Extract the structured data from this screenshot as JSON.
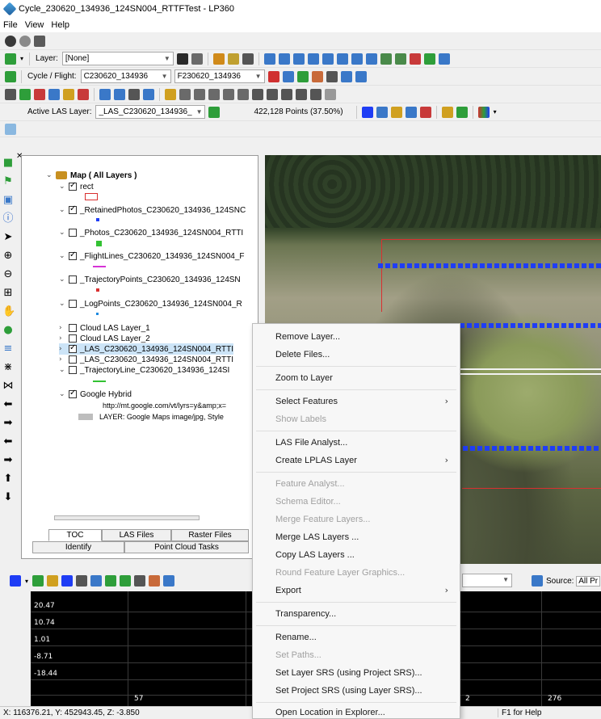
{
  "window": {
    "title": "Cycle_230620_134936_124SN004_RTTFTest - LP360"
  },
  "menu": [
    "File",
    "View",
    "Help"
  ],
  "toolbar": {
    "layer_label": "Layer:",
    "layer_value": "[None]",
    "cycle_label": "Cycle / Flight:",
    "cycle_value": "C230620_134936",
    "flight_value": "F230620_134936",
    "active_las_label": "Active LAS Layer:",
    "active_las_value": "_LAS_C230620_134936_",
    "points_text": "422,128 Points (37.50%)"
  },
  "toc": {
    "tree": [
      {
        "label": "Map ( All Layers )",
        "bold": true
      },
      {
        "label": "rect",
        "checked": true
      },
      {
        "label": "_RetainedPhotos_C230620_134936_124SNC",
        "checked": true
      },
      {
        "label": "_Photos_C230620_134936_124SN004_RTTI",
        "checked": false
      },
      {
        "label": "_FlightLines_C230620_134936_124SN004_F",
        "checked": true
      },
      {
        "label": "_TrajectoryPoints_C230620_134936_124SN",
        "checked": false
      },
      {
        "label": "_LogPoints_C230620_134936_124SN004_R",
        "checked": false
      },
      {
        "label": "Cloud LAS Layer_1",
        "checked": false
      },
      {
        "label": "Cloud LAS Layer_2",
        "checked": false
      },
      {
        "label": "_LAS_C230620_134936_124SN004_RTTI",
        "checked": true
      },
      {
        "label": "_LAS_C230620_134936_124SN004_RTTI",
        "checked": false
      },
      {
        "label": "_TrajectoryLine_C230620_134936_124SI",
        "checked": false
      },
      {
        "label": "Google Hybrid",
        "checked": true
      },
      {
        "label": "http://mt.google.com/vt/lyrs=y&amp;x="
      },
      {
        "label": "LAYER: Google Maps image/jpg, Style"
      }
    ],
    "tabs_row1": [
      "TOC",
      "LAS Files",
      "Raster Files"
    ],
    "tabs_row2": [
      "Identify",
      "Point Cloud Tasks"
    ]
  },
  "profile": {
    "y_labels": [
      "20.47",
      "10.74",
      "1.01",
      "-8.71",
      "-18.44"
    ],
    "x_labels": [
      "57",
      "2",
      "276"
    ],
    "source_label": "Source:",
    "source_value": "All Pr"
  },
  "status": {
    "coords": "X: 116376.21, Y: 452943.45, Z: -3.850",
    "help": "F1 for Help"
  },
  "context_menu": [
    {
      "label": "Remove Layer...",
      "disabled": false,
      "submenu": false
    },
    {
      "label": "Delete Files...",
      "disabled": false,
      "submenu": false
    },
    {
      "label": "Zoom to Layer",
      "disabled": false,
      "submenu": false
    },
    {
      "label": "Select Features",
      "disabled": false,
      "submenu": true
    },
    {
      "label": "Show Labels",
      "disabled": true,
      "submenu": false
    },
    {
      "label": "LAS File Analyst...",
      "disabled": false,
      "submenu": false
    },
    {
      "label": "Create LPLAS Layer",
      "disabled": false,
      "submenu": true
    },
    {
      "label": "Feature Analyst...",
      "disabled": true,
      "submenu": false
    },
    {
      "label": "Schema Editor...",
      "disabled": true,
      "submenu": false
    },
    {
      "label": "Merge Feature Layers...",
      "disabled": true,
      "submenu": false
    },
    {
      "label": "Merge LAS Layers ...",
      "disabled": false,
      "submenu": false
    },
    {
      "label": "Copy LAS Layers ...",
      "disabled": false,
      "submenu": false
    },
    {
      "label": "Round Feature Layer Graphics...",
      "disabled": true,
      "submenu": false
    },
    {
      "label": "Export",
      "disabled": false,
      "submenu": true
    },
    {
      "label": "Transparency...",
      "disabled": false,
      "submenu": false
    },
    {
      "label": "Rename...",
      "disabled": false,
      "submenu": false
    },
    {
      "label": "Set Paths...",
      "disabled": true,
      "submenu": false
    },
    {
      "label": "Set Layer SRS (using Project SRS)...",
      "disabled": false,
      "submenu": false
    },
    {
      "label": "Set Project SRS (using Layer SRS)...",
      "disabled": false,
      "submenu": false
    },
    {
      "label": "Open Location in Explorer...",
      "disabled": false,
      "submenu": false
    }
  ],
  "colors": {
    "accent_blue": "#1f3df5",
    "red_outline": "#d93030",
    "green_legend": "#33c233",
    "magenta_legend": "#d633d6"
  }
}
